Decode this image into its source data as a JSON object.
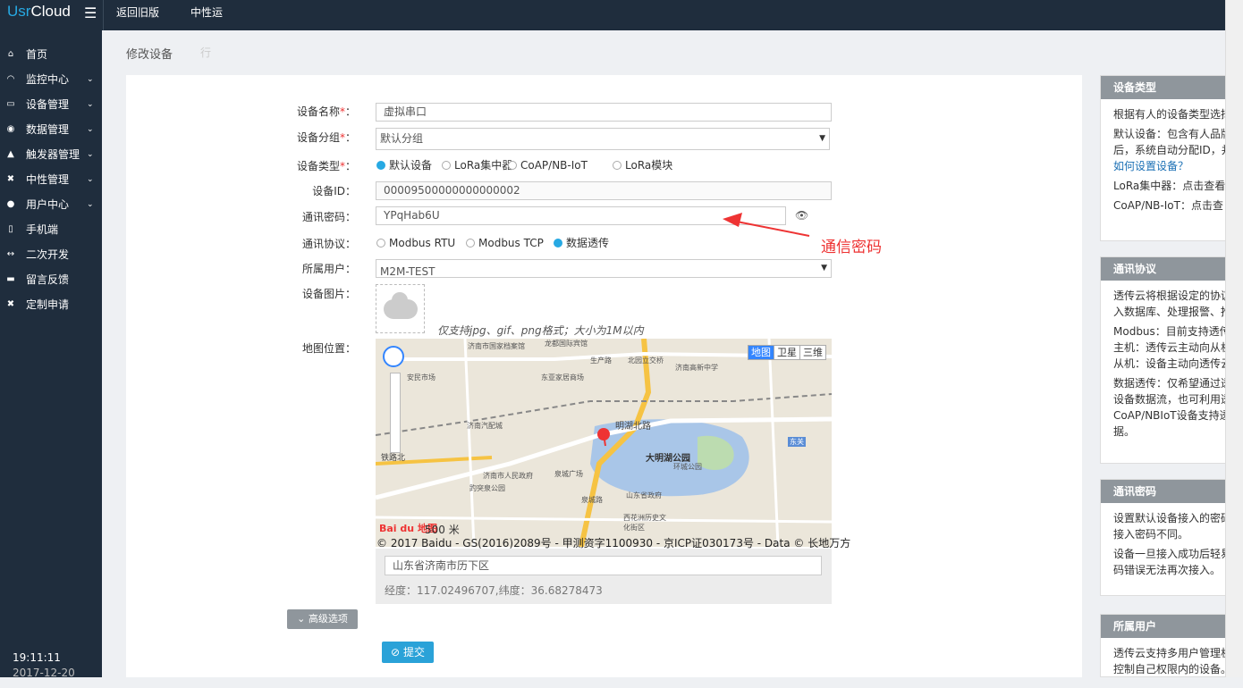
{
  "topbar": {
    "logo_a": "Usr",
    "logo_b": "Cloud",
    "nav": [
      "返回旧版",
      "中性运"
    ]
  },
  "sidebar": {
    "items": [
      {
        "icon": "home-icon",
        "glyph": "⌂",
        "label": "首页",
        "chevron": false
      },
      {
        "icon": "monitor-icon",
        "glyph": "◠",
        "label": "监控中心",
        "chevron": true
      },
      {
        "icon": "device-icon",
        "glyph": "▭",
        "label": "设备管理",
        "chevron": true
      },
      {
        "icon": "data-icon",
        "glyph": "◉",
        "label": "数据管理",
        "chevron": true
      },
      {
        "icon": "bell-icon",
        "glyph": "▲",
        "label": "触发器管理",
        "chevron": true
      },
      {
        "icon": "tools-icon",
        "glyph": "✖",
        "label": "中性管理",
        "chevron": true
      },
      {
        "icon": "users-icon",
        "glyph": "●",
        "label": "用户中心",
        "chevron": true
      },
      {
        "icon": "mobile-icon",
        "glyph": "▯",
        "label": "手机端",
        "chevron": false
      },
      {
        "icon": "code-icon",
        "glyph": "↔",
        "label": "二次开发",
        "chevron": false
      },
      {
        "icon": "comment-icon",
        "glyph": "▬",
        "label": "留言反馈",
        "chevron": false
      },
      {
        "icon": "wrench-icon",
        "glyph": "✖",
        "label": "定制申请",
        "chevron": false
      }
    ],
    "time": "19:11:11",
    "date": "2017-12-20"
  },
  "breadcrumb": {
    "title": "修改设备",
    "sub": "行"
  },
  "form": {
    "name_label": "设备名称",
    "name_value": "虚拟串口",
    "group_label": "设备分组",
    "group_value": "默认分组",
    "type_label": "设备类型",
    "type_options": [
      "默认设备",
      "LoRa集中器",
      "CoAP/NB-IoT",
      "LoRa模块"
    ],
    "type_selected": 0,
    "id_label": "设备ID",
    "id_value": "00009500000000000002",
    "pwd_label": "通讯密码",
    "pwd_value": "YPqHab6U",
    "proto_label": "通讯协议",
    "proto_options": [
      "Modbus RTU",
      "Modbus TCP",
      "数据透传"
    ],
    "proto_selected": 2,
    "user_label": "所属用户",
    "user_value": "M2M-TEST",
    "image_label": "设备图片",
    "image_hint": "仅支持jpg、gif、png格式；大小为1M以内",
    "map_label": "地图位置",
    "required_mark": "*",
    "colon": "："
  },
  "map": {
    "type_buttons": [
      "地图",
      "卫星",
      "三维"
    ],
    "scale": "500 米",
    "logo": "Bai du 地图",
    "copyright": "© 2017 Baidu - GS(2016)2089号 - 甲测资字1100930 - 京ICP证030173号 - Data © 长地万方",
    "labels": [
      "济南市国家档案馆",
      "龙都国际宾馆",
      "生产路",
      "北园立交桥",
      "济南高新中学",
      "安民市场",
      "东亚家居商场",
      "济南汽配城",
      "明湖北路",
      "大明湖公园",
      "泉城广场",
      "趵突泉公园",
      "环城公园",
      "济南市人民政府",
      "泉城路",
      "山东省政府",
      "西花洲历史文化街区",
      "东关",
      "铁路北"
    ],
    "address": "山东省济南市历下区",
    "coords": "经度：117.02496707,纬度：36.68278473"
  },
  "buttons": {
    "advanced": "高级选项",
    "submit": "提交"
  },
  "annotation": "通信密码",
  "help": [
    {
      "title": "设备类型",
      "lines": [
        "根据有人的设备类型选择",
        "默认设备：包含有人品牌",
        "后，系统自动分配ID，并",
        "如何设置设备？",
        "LoRa集中器：点击查看",
        "CoAP/NB-IoT：点击查"
      ]
    },
    {
      "title": "通讯协议",
      "lines": [
        "透传云将根据设定的协议",
        "入数据库、处理报警、推",
        "Modbus：目前支持透传",
        "主机：透传云主动向从机",
        "从机：设备主动向透传云",
        "数据透传：仅希望通过透",
        "设备数据流，也可利用透",
        "CoAP/NBIoT设备支持透",
        "据。"
      ]
    },
    {
      "title": "通讯密码",
      "lines": [
        "设置默认设备接入的密码",
        "接入密码不同。",
        "设备一旦接入成功后轻易",
        "码错误无法再次接入。"
      ]
    },
    {
      "title": "所属用户",
      "lines": [
        "透传云支持多用户管理机",
        "控制自己权限内的设备。"
      ]
    }
  ]
}
